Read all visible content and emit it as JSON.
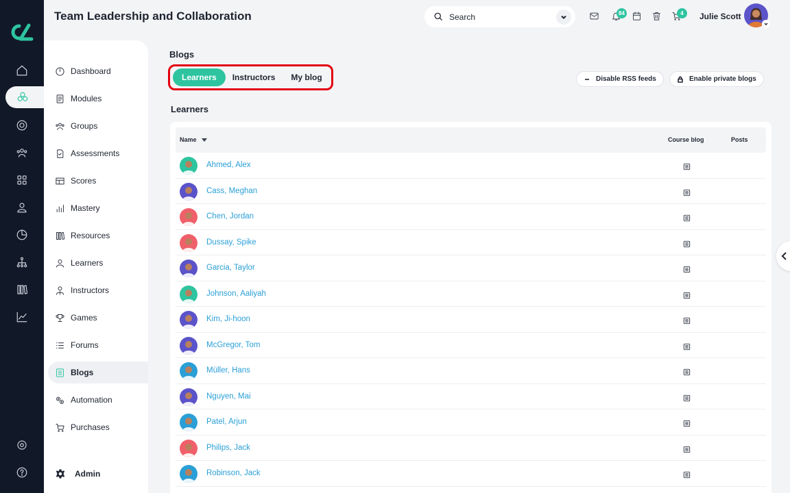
{
  "header": {
    "title": "Team Leadership and Collaboration",
    "search_placeholder": "Search",
    "notifications_count": "84",
    "cart_count": "4",
    "user_name": "Julie Scott"
  },
  "sidebar": {
    "items": [
      {
        "label": "Dashboard",
        "icon": "dashboard-icon"
      },
      {
        "label": "Modules",
        "icon": "modules-icon"
      },
      {
        "label": "Groups",
        "icon": "groups-icon"
      },
      {
        "label": "Assessments",
        "icon": "assessments-icon"
      },
      {
        "label": "Scores",
        "icon": "scores-icon"
      },
      {
        "label": "Mastery",
        "icon": "mastery-icon"
      },
      {
        "label": "Resources",
        "icon": "resources-icon"
      },
      {
        "label": "Learners",
        "icon": "learners-icon"
      },
      {
        "label": "Instructors",
        "icon": "instructors-icon"
      },
      {
        "label": "Games",
        "icon": "trophy-icon"
      },
      {
        "label": "Forums",
        "icon": "forums-icon"
      },
      {
        "label": "Blogs",
        "icon": "blogs-icon",
        "active": true
      },
      {
        "label": "Automation",
        "icon": "automation-icon"
      },
      {
        "label": "Purchases",
        "icon": "cart-icon"
      }
    ],
    "admin_label": "Admin"
  },
  "main": {
    "page_label": "Blogs",
    "tabs": [
      {
        "label": "Learners",
        "active": true
      },
      {
        "label": "Instructors"
      },
      {
        "label": "My blog"
      }
    ],
    "disable_rss_label": "Disable RSS feeds",
    "enable_private_label": "Enable private blogs",
    "section_title": "Learners",
    "table": {
      "columns": [
        "Name",
        "Course blog",
        "Posts"
      ],
      "rows": [
        {
          "name": "Ahmed, Alex",
          "avatar_color": "#2ec4a0"
        },
        {
          "name": "Cass, Meghan",
          "avatar_color": "#5b53c9"
        },
        {
          "name": "Chen, Jordan",
          "avatar_color": "#f0606a"
        },
        {
          "name": "Dussay, Spike",
          "avatar_color": "#f0606a"
        },
        {
          "name": "Garcia, Taylor",
          "avatar_color": "#5b53c9"
        },
        {
          "name": "Johnson, Aaliyah",
          "avatar_color": "#2ec4a0"
        },
        {
          "name": "Kim, Ji-hoon",
          "avatar_color": "#5b53c9"
        },
        {
          "name": "McGregor, Tom",
          "avatar_color": "#5b53c9"
        },
        {
          "name": "Müller, Hans",
          "avatar_color": "#2a9fd6"
        },
        {
          "name": "Nguyen, Mai",
          "avatar_color": "#5b53c9"
        },
        {
          "name": "Patel, Arjun",
          "avatar_color": "#2a9fd6"
        },
        {
          "name": "Philips, Jack",
          "avatar_color": "#f0606a"
        },
        {
          "name": "Robinson, Jack",
          "avatar_color": "#2a9fd6"
        }
      ]
    }
  },
  "colors": {
    "accent": "#2ec4a0",
    "link": "#2a9fd6",
    "rail": "#111827",
    "highlight": "#e3000f"
  }
}
